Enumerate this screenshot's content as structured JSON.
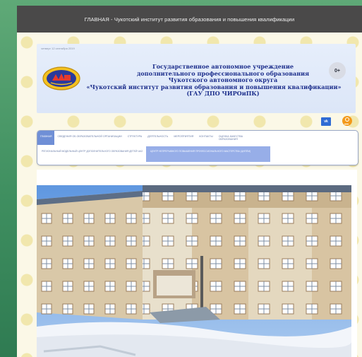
{
  "topbar": {
    "title": "ГЛАВНАЯ - Чукотский институт развития образования и повышения квалификации"
  },
  "header": {
    "date": "четверг 12 сентября 2019",
    "org_lines": [
      "Государственное автономное учреждение",
      "дополнительного профессионального образования",
      "Чукотского автономного округа",
      "«Чукотский институт развития образования и повышения квалификации»",
      "(ГАУ ДПО ЧИРОиПК)"
    ],
    "age_rating": "0+"
  },
  "social": {
    "vk_label": "vk"
  },
  "nav": {
    "items": [
      "Главная",
      "Сведения об образовательной организации",
      "Структура",
      "Деятельность",
      "Мероприятия",
      "Контакты",
      "Оценка качества образования"
    ],
    "subitems": [
      "Региональный модельный центр дополнительного образования детей ЧАО",
      "Центр непрерывного повышения профессионального мастерства (ЦНППМ)"
    ]
  },
  "colors": {
    "accent": "#1d2f8c",
    "nav_active": "#6f8fd6",
    "topbar": "#4a4949"
  }
}
